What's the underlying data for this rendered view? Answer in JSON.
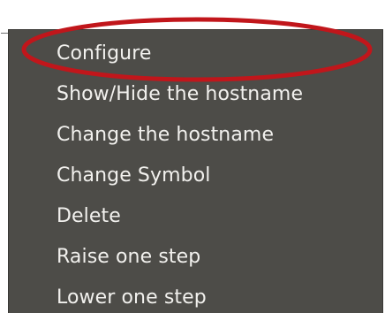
{
  "menu": {
    "items": [
      {
        "label": "Configure"
      },
      {
        "label": "Show/Hide the hostname"
      },
      {
        "label": "Change the hostname"
      },
      {
        "label": "Change Symbol"
      },
      {
        "label": "Delete"
      },
      {
        "label": "Raise one step"
      },
      {
        "label": "Lower one step"
      }
    ]
  },
  "colors": {
    "menu_background": "#4d4c48",
    "menu_text": "#f2f1ee",
    "annotation_ring": "#c1161b"
  }
}
